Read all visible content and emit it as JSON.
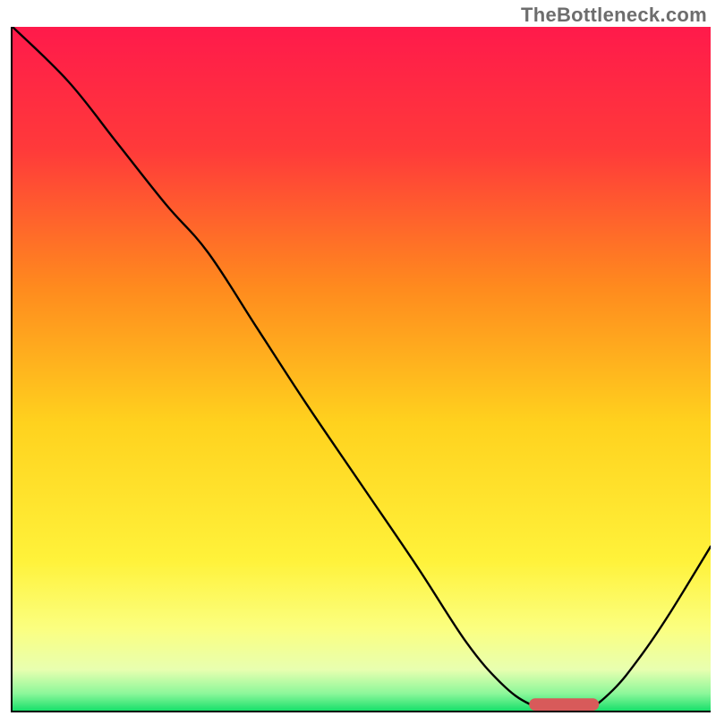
{
  "attribution": "TheBottleneck.com",
  "chart_data": {
    "type": "line",
    "title": "",
    "xlabel": "",
    "ylabel": "",
    "xlim": [
      0,
      100
    ],
    "ylim": [
      0,
      100
    ],
    "x": [
      0,
      8,
      15,
      22,
      28,
      35,
      42,
      50,
      58,
      65,
      70,
      74,
      78,
      82,
      86,
      90,
      94,
      100
    ],
    "values": [
      100,
      92,
      83,
      74,
      67,
      56,
      45,
      33,
      21,
      10,
      4,
      1,
      0,
      0,
      3,
      8,
      14,
      24
    ],
    "gradient_stops": [
      {
        "pos": 0.0,
        "color": "#ff1a4b"
      },
      {
        "pos": 0.18,
        "color": "#ff3a3a"
      },
      {
        "pos": 0.38,
        "color": "#ff8a1e"
      },
      {
        "pos": 0.58,
        "color": "#ffd21e"
      },
      {
        "pos": 0.78,
        "color": "#fff23a"
      },
      {
        "pos": 0.88,
        "color": "#fbff80"
      },
      {
        "pos": 0.94,
        "color": "#e8ffb0"
      },
      {
        "pos": 0.975,
        "color": "#8cf79a"
      },
      {
        "pos": 1.0,
        "color": "#18e06b"
      }
    ],
    "marker": {
      "x_start": 74,
      "x_end": 84,
      "y": 0,
      "color": "#d85a5a",
      "thickness_frac": 0.018,
      "radius_frac": 0.009
    }
  }
}
